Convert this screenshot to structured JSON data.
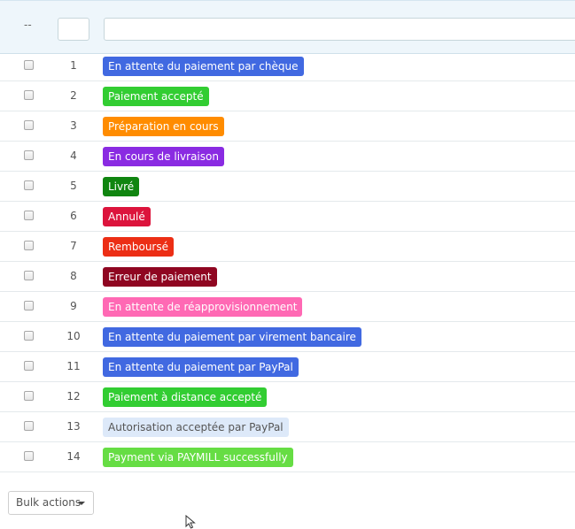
{
  "filter": {
    "dash": "--"
  },
  "rows": [
    {
      "id": "1",
      "label": "En attente du paiement par chèque",
      "bg": "#4169e1",
      "fg": "#ffffff"
    },
    {
      "id": "2",
      "label": "Paiement accepté",
      "bg": "#32cd32",
      "fg": "#ffffff"
    },
    {
      "id": "3",
      "label": "Préparation en cours",
      "bg": "#ff8c00",
      "fg": "#ffffff"
    },
    {
      "id": "4",
      "label": "En cours de livraison",
      "bg": "#8a2be2",
      "fg": "#ffffff"
    },
    {
      "id": "5",
      "label": "Livré",
      "bg": "#108510",
      "fg": "#ffffff"
    },
    {
      "id": "6",
      "label": "Annulé",
      "bg": "#dc143c",
      "fg": "#ffffff"
    },
    {
      "id": "7",
      "label": "Remboursé",
      "bg": "#ec2e15",
      "fg": "#ffffff"
    },
    {
      "id": "8",
      "label": "Erreur de paiement",
      "bg": "#8f0621",
      "fg": "#ffffff"
    },
    {
      "id": "9",
      "label": "En attente de réapprovisionnement",
      "bg": "#ff69b4",
      "fg": "#ffffff"
    },
    {
      "id": "10",
      "label": "En attente du paiement par virement bancaire",
      "bg": "#4169e1",
      "fg": "#ffffff"
    },
    {
      "id": "11",
      "label": "En attente du paiement par PayPal",
      "bg": "#4169e1",
      "fg": "#ffffff"
    },
    {
      "id": "12",
      "label": "Paiement à distance accepté",
      "bg": "#32cd32",
      "fg": "#ffffff"
    },
    {
      "id": "13",
      "label": "Autorisation acceptée par PayPal",
      "bg": "#dde9f9",
      "fg": "#555555"
    },
    {
      "id": "14",
      "label": "Payment via PAYMILL successfully",
      "bg": "#66dd44",
      "fg": "#ffffff"
    }
  ],
  "bulk": {
    "label": "Bulk actions"
  }
}
